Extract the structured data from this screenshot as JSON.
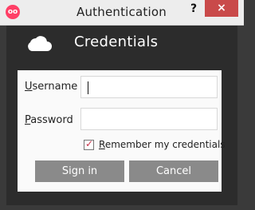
{
  "window": {
    "title": "Authentication",
    "help_label": "?",
    "close_label": "×"
  },
  "header": {
    "title": "Credentials"
  },
  "form": {
    "username": {
      "label_first": "U",
      "label_rest": "sername",
      "value": ""
    },
    "password": {
      "label_first": "P",
      "label_rest": "assword",
      "value": ""
    },
    "remember": {
      "label_first": "R",
      "label_rest": "emember my credentials",
      "checked": true
    }
  },
  "buttons": {
    "sign_in": "Sign in",
    "cancel": "Cancel"
  },
  "colors": {
    "accent": "#ff3f66",
    "close": "#c94a4a",
    "dark": "#2c2c2c",
    "button": "#8a8a8a"
  }
}
